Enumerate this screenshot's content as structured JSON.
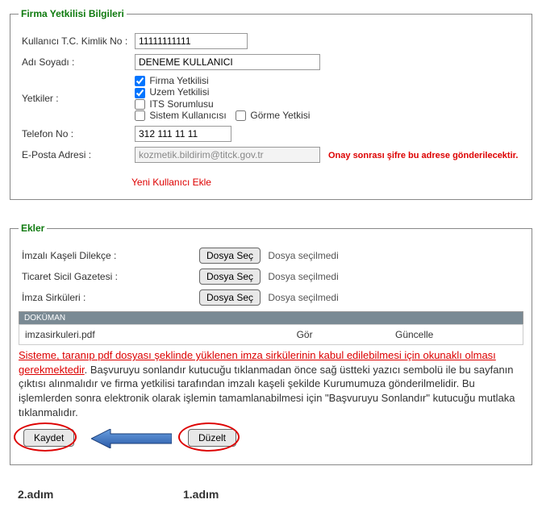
{
  "fieldset1": {
    "legend": "Firma Yetkilisi Bilgileri",
    "tc_label": "Kullanıcı T.C. Kimlik No :",
    "tc_value": "11111111111",
    "ad_label": "Adı Soyadı :",
    "ad_value": "DENEME KULLANICI",
    "yetki_label": "Yetkiler :",
    "cb_firma": "Firma Yetkilisi",
    "cb_uzem": "Uzem Yetkilisi",
    "cb_its": "ITS Sorumlusu",
    "cb_sistem": "Sistem Kullanıcısı",
    "cb_gorme": "Görme Yetkisi",
    "tel_label": "Telefon No :",
    "tel_value": "312 111 11 11",
    "eposta_label": "E-Posta Adresi :",
    "eposta_value": "kozmetik.bildirim@titck.gov.tr",
    "eposta_note": "Onay sonrası şifre bu adrese gönderilecektir.",
    "add_link": "Yeni Kullanıcı Ekle"
  },
  "fieldset2": {
    "legend": "Ekler",
    "rows": [
      {
        "label": "İmzalı Kaşeli Dilekçe :",
        "btn": "Dosya Seç",
        "status": "Dosya seçilmedi"
      },
      {
        "label": "Ticaret Sicil Gazetesi :",
        "btn": "Dosya Seç",
        "status": "Dosya seçilmedi"
      },
      {
        "label": "İmza Sirküleri :",
        "btn": "Dosya Seç",
        "status": "Dosya seçilmedi"
      }
    ],
    "dok_header": "DOKÜMAN",
    "dok_filename": "imzasirkuleri.pdf",
    "dok_gor": "Gör",
    "dok_guncelle": "Güncelle",
    "warn_part1": "Sisteme, taranıp pdf dosyası şeklinde yüklenen imza sirkülerinin kabul edilebilmesi için okunaklı olması gerekmektedir",
    "warn_part2": ". Başvuruyu sonlandır kutucuğu tıklanmadan önce sağ üstteki yazıcı sembolü ile bu sayfanın çıktısı alınmalıdır ve firma yetkilisi tarafından imzalı kaşeli şekilde Kurumumuza gönderilmelidir. Bu işlemlerden sonra elektronik olarak işlemin tamamlanabilmesi için \"Başvuruyu Sonlandır\" kutucuğu mutlaka tıklanmalıdır.",
    "kaydet": "Kaydet",
    "duzelt": "Düzelt"
  },
  "steps": {
    "s1": "1.adım",
    "s2": "2.adım"
  }
}
